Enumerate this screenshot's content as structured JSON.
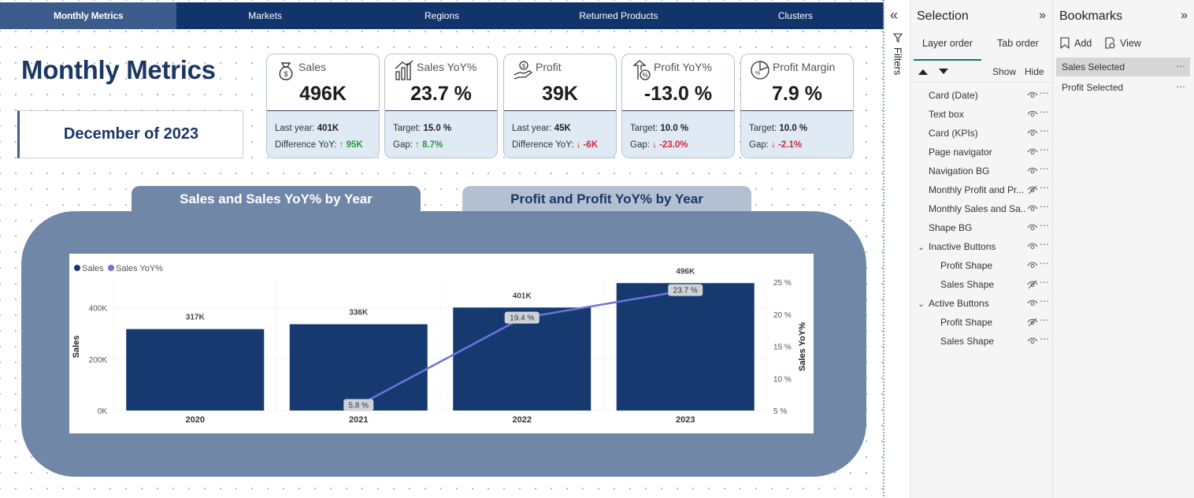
{
  "nav": [
    {
      "label": "Monthly Metrics"
    },
    {
      "label": "Markets"
    },
    {
      "label": "Regions"
    },
    {
      "label": "Returned Products"
    },
    {
      "label": "Clusters"
    }
  ],
  "page_title": "Monthly Metrics",
  "date_card": "December of 2023",
  "kpis": {
    "sales": {
      "name": "Sales",
      "value": "496K",
      "l1_label": "Last year: ",
      "l1_value": "401K",
      "l2_label": "Difference YoY: ",
      "l2_arrow": "↑",
      "l2_value": "95K"
    },
    "sales_yoy": {
      "name": "Sales YoY%",
      "value": "23.7 %",
      "l1_label": "Target: ",
      "l1_value": "15.0 %",
      "l2_label": "Gap: ",
      "l2_arrow": "↑",
      "l2_value": "8.7%"
    },
    "profit": {
      "name": "Profit",
      "value": "39K",
      "l1_label": "Last year: ",
      "l1_value": "45K",
      "l2_label": "Difference YoY: ",
      "l2_arrow": "↓",
      "l2_value": "-6K"
    },
    "profit_yoy": {
      "name": "Profit YoY%",
      "value": "-13.0 %",
      "l1_label": "Target: ",
      "l1_value": "10.0 %",
      "l2_label": "Gap: ",
      "l2_arrow": "↓",
      "l2_value": "-23.0%"
    },
    "profit_margin": {
      "name": "Profit Margin",
      "value": "7.9 %",
      "l1_label": "Target: ",
      "l1_value": "10.0 %",
      "l2_label": "Gap: ",
      "l2_arrow": "↓",
      "l2_value": "-2.1%"
    }
  },
  "chart_tabs": {
    "sales": "Sales and Sales YoY% by Year",
    "profit": "Profit and Profit YoY% by Year"
  },
  "chart_data": {
    "type": "bar",
    "title": "",
    "categories": [
      "2020",
      "2021",
      "2022",
      "2023"
    ],
    "series": [
      {
        "name": "Sales",
        "kind": "bar",
        "values": [
          317,
          336,
          401,
          496
        ],
        "labels": [
          "317K",
          "336K",
          "401K",
          "496K"
        ],
        "color": "#163a70"
      },
      {
        "name": "Sales YoY%",
        "kind": "line",
        "axis": "right",
        "values": [
          null,
          5.8,
          19.4,
          23.7
        ],
        "labels": [
          "",
          "5.8 %",
          "19.4 %",
          "23.7 %"
        ],
        "color": "#6c74dc"
      }
    ],
    "ylabel": "Sales",
    "y2label": "Sales YoY%",
    "ylim": [
      0,
      500
    ],
    "yticks": [
      "0K",
      "200K",
      "400K"
    ],
    "y2lim": [
      5,
      25
    ],
    "y2ticks": [
      "5 %",
      "10 %",
      "15 %",
      "20 %",
      "25 %"
    ],
    "legend_position": "top-left",
    "grid": true
  },
  "selection": {
    "title": "Selection",
    "collapse": "»",
    "tab_layer": "Layer order",
    "tab_tab": "Tab order",
    "show": "Show",
    "hide": "Hide",
    "layers": [
      {
        "name": "Card (Date)",
        "indent": 0,
        "hidden": false
      },
      {
        "name": "Text box",
        "indent": 0,
        "hidden": false
      },
      {
        "name": "Card (KPIs)",
        "indent": 0,
        "hidden": false
      },
      {
        "name": "Page navigator",
        "indent": 0,
        "hidden": false
      },
      {
        "name": "Navigation BG",
        "indent": 0,
        "hidden": false
      },
      {
        "name": "Monthly Profit and Pr...",
        "indent": 0,
        "hidden": true
      },
      {
        "name": "Monthly Sales and Sa...",
        "indent": 0,
        "hidden": false
      },
      {
        "name": "Shape BG",
        "indent": 0,
        "hidden": false
      },
      {
        "name": "Inactive Buttons",
        "indent": 0,
        "hidden": false,
        "group": true
      },
      {
        "name": "Profit Shape",
        "indent": 1,
        "hidden": false
      },
      {
        "name": "Sales Shape",
        "indent": 1,
        "hidden": true
      },
      {
        "name": "Active Buttons",
        "indent": 0,
        "hidden": false,
        "group": true
      },
      {
        "name": "Profit Shape",
        "indent": 1,
        "hidden": true
      },
      {
        "name": "Sales Shape",
        "indent": 1,
        "hidden": false
      }
    ]
  },
  "bookmarks": {
    "title": "Bookmarks",
    "collapse": "»",
    "add": "Add",
    "view": "View",
    "items": [
      {
        "name": "Sales Selected",
        "selected": true
      },
      {
        "name": "Profit Selected",
        "selected": false
      }
    ]
  },
  "filters_label": "Filters",
  "colors": {
    "navy": "#11346a",
    "accent": "#7087a8",
    "up": "#2a9a3c",
    "down": "#d1283b"
  }
}
